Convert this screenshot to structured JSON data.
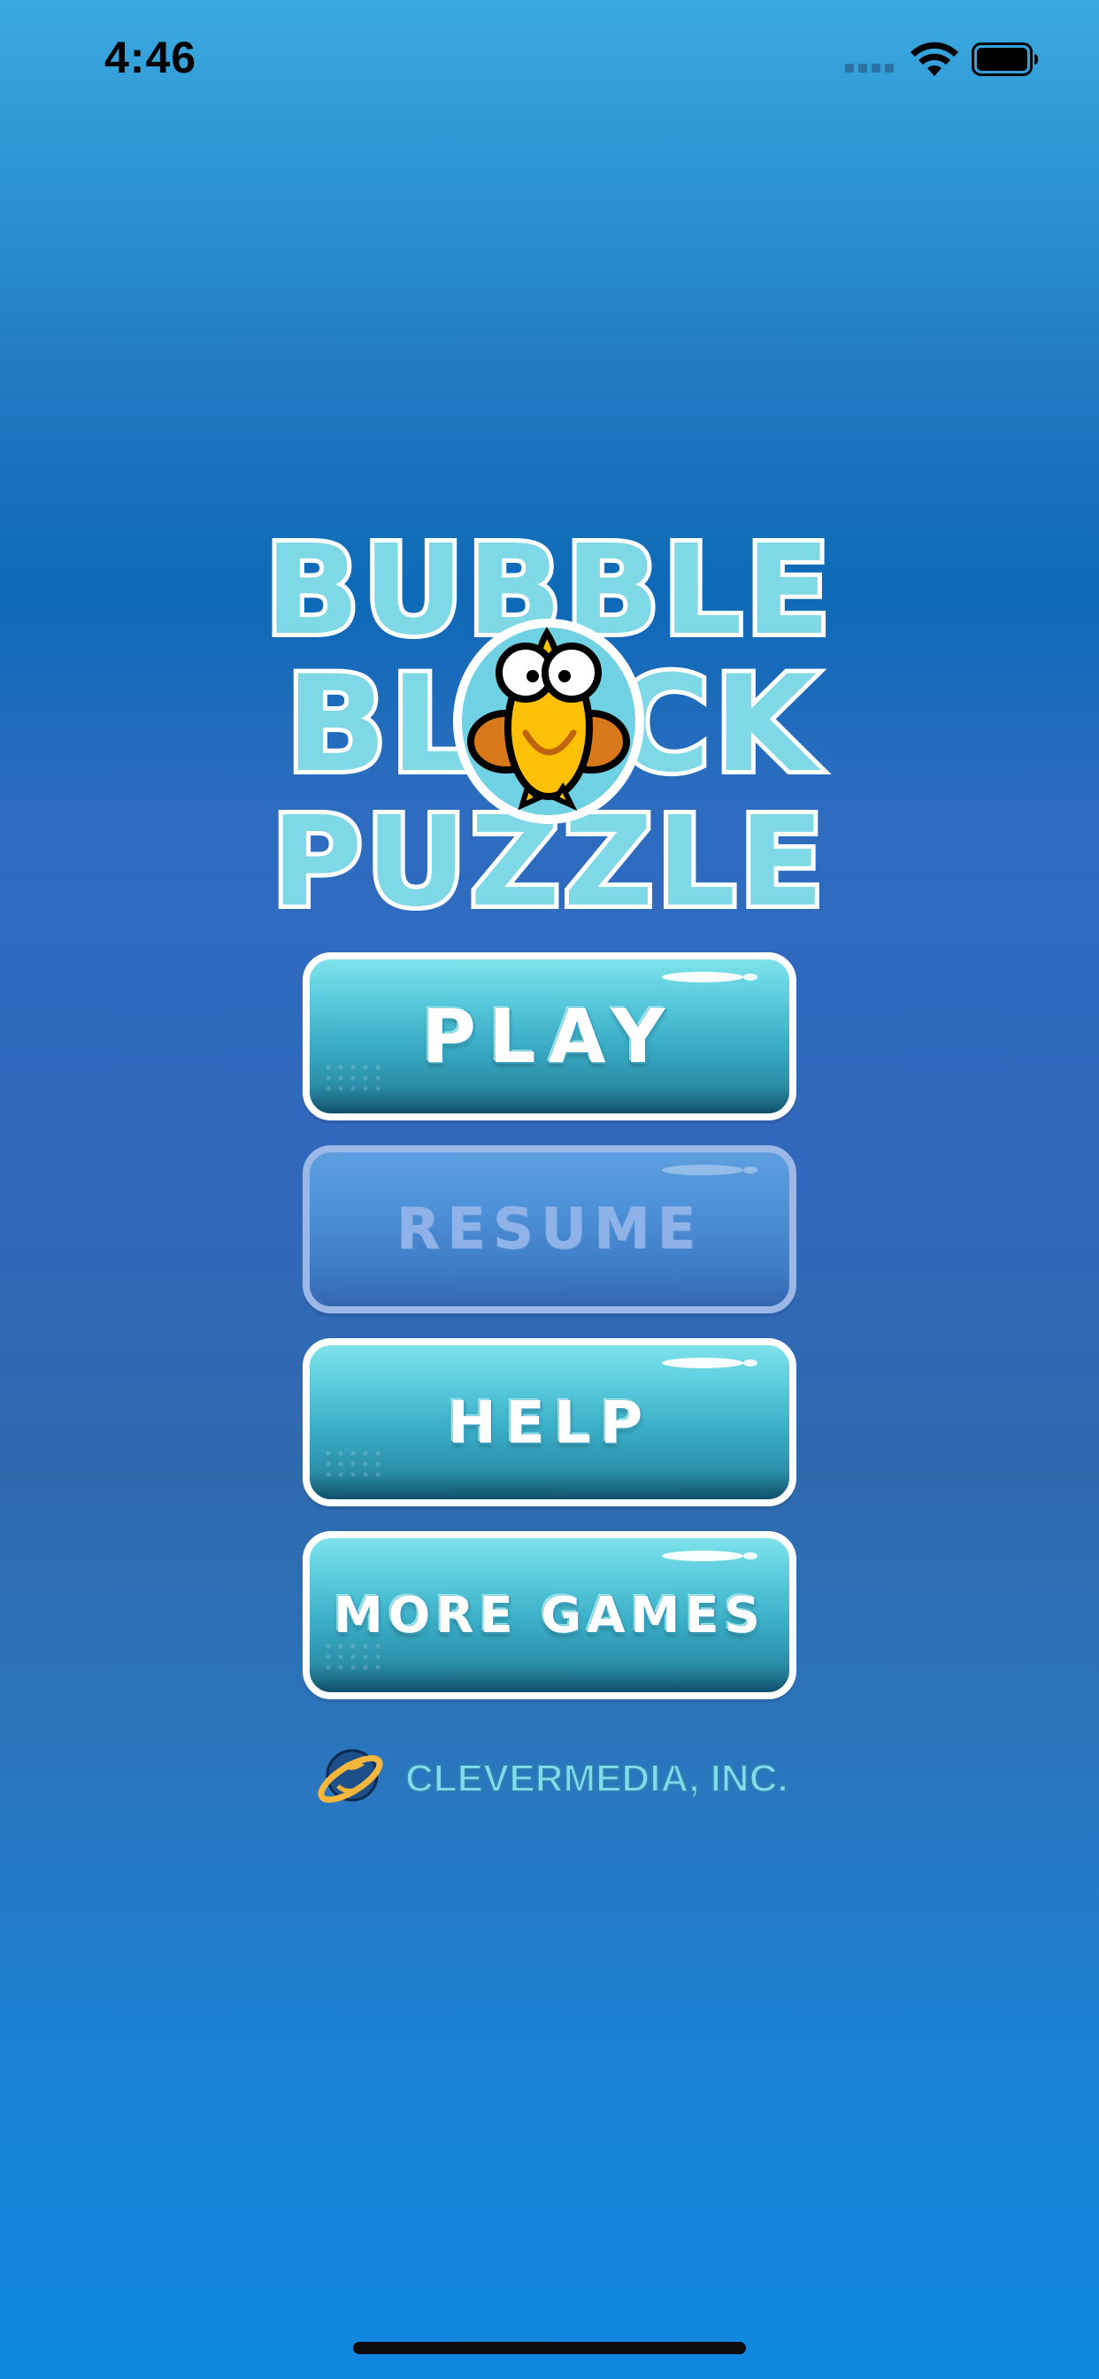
{
  "status_bar": {
    "time": "4:46",
    "icons": [
      "cellular-signal-icon",
      "wifi-icon",
      "battery-icon"
    ]
  },
  "logo": {
    "line1": "BUBBLE",
    "line2_left": "BL",
    "line2_right": "CK",
    "line3": "PUZZLE",
    "mascot": "yellow-fish-mascot-icon",
    "colors": {
      "fill": "#7fd8e6",
      "outline": "#ffffff",
      "mascot": "#ffc107"
    }
  },
  "menu": {
    "play_label": "PLAY",
    "resume_label": "RESUME",
    "help_label": "HELP",
    "more_games_label": "MORE GAMES"
  },
  "footer": {
    "company_name": "CLEVERMEDIA, INC.",
    "company_icon": "clevermedia-planet-logo-icon"
  },
  "colors": {
    "button_top": "#7ee2ea",
    "button_bottom": "#0f4f6a",
    "disabled_button": "#4c8fd6",
    "background_top": "#3aa9df",
    "background_bottom": "#1088e0"
  }
}
